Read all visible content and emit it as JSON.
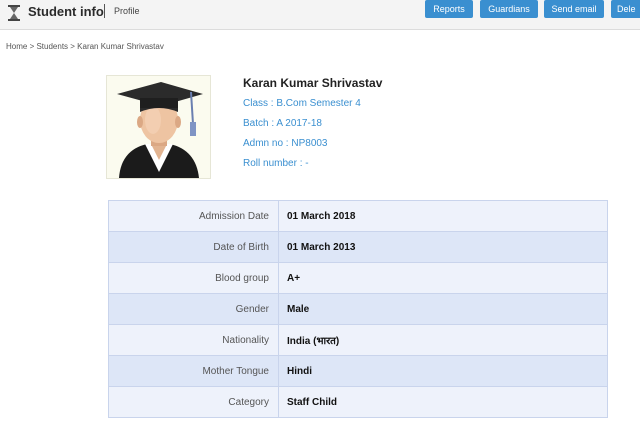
{
  "header": {
    "title": "Student info",
    "subtitle": "Profile",
    "buttons": [
      "Reports",
      "Guardians",
      "Send email",
      "Dele"
    ]
  },
  "breadcrumb": "Home > Students > Karan Kumar Shrivastav",
  "profile": {
    "name": "Karan Kumar Shrivastav",
    "class_line": "Class : B.Com Semester 4",
    "batch_line": "Batch : A 2017-18",
    "admn_line": "Admn no : NP8003",
    "roll_line": "Roll number : -"
  },
  "details": [
    {
      "label": "Admission Date",
      "value": "01 March 2018"
    },
    {
      "label": "Date of Birth",
      "value": "01 March 2013"
    },
    {
      "label": "Blood group",
      "value": "A+"
    },
    {
      "label": "Gender",
      "value": "Male"
    },
    {
      "label": "Nationality",
      "value": "India (भारत)"
    },
    {
      "label": "Mother Tongue",
      "value": "Hindi"
    },
    {
      "label": "Category",
      "value": "Staff Child"
    }
  ],
  "colors": {
    "accent": "#3a8fd0",
    "row_light": "#eef2fb",
    "row_dark": "#dde6f7"
  },
  "icons": {
    "app_icon": "hourglass-icon",
    "avatar": "graduate-avatar"
  }
}
